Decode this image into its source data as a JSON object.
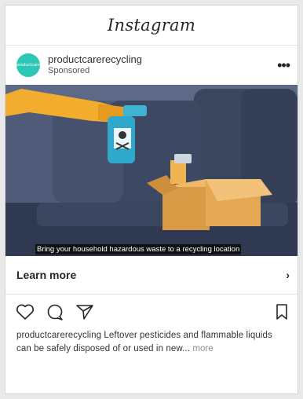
{
  "app": {
    "logo": "Instagram"
  },
  "post": {
    "username": "productcarerecycling",
    "subtitle": "Sponsored",
    "avatar_text": "productcare",
    "media_caption": "Bring your household hazardous waste to a recycling location",
    "cta_label": "Learn more",
    "description_user": "productcarerecycling",
    "description_text": " Leftover pesticides and flammable liquids can be safely disposed of or used in new...",
    "more_label": " more"
  },
  "icons": [
    "more-options-icon",
    "chevron-right-icon",
    "heart-icon",
    "comment-icon",
    "share-icon",
    "bookmark-icon"
  ],
  "colors": {
    "avatar": "#2cc7b5",
    "media_bg": "#505c7a",
    "box": "#d99a45"
  }
}
